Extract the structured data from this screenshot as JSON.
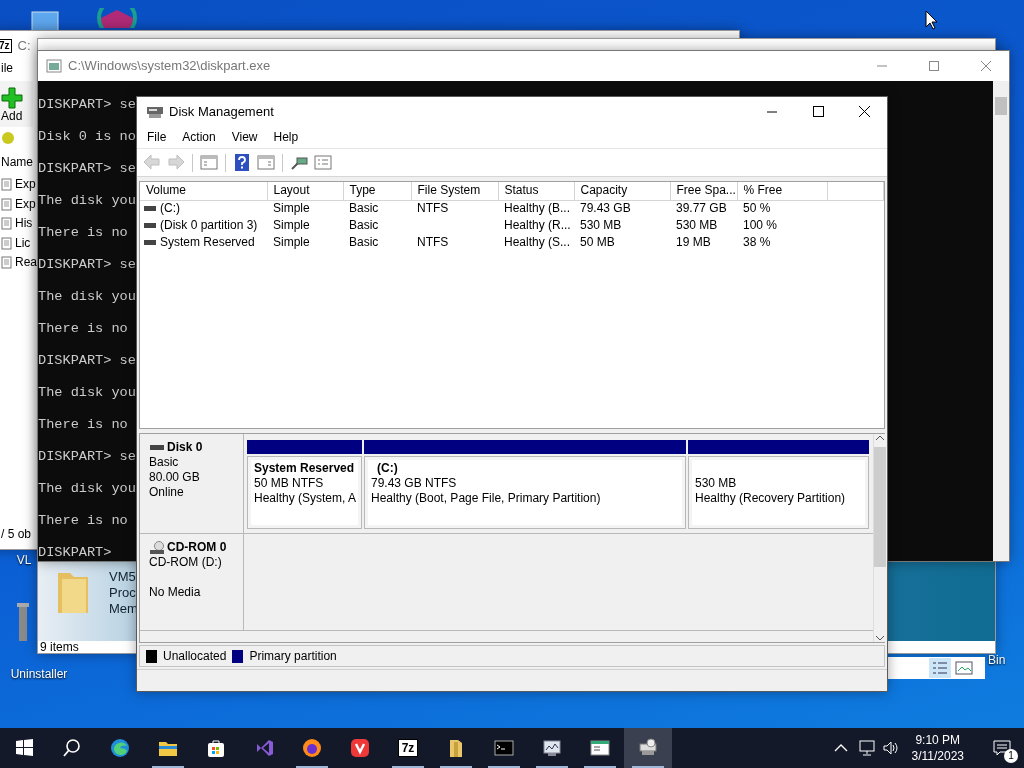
{
  "desktop": {
    "icons": [
      {
        "label": "VL"
      },
      {
        "label": "Uninstaller"
      },
      {
        "label": "Bin"
      }
    ]
  },
  "sevenzip_window": {
    "icon_label": "7z",
    "title": "C:",
    "menu": [
      "ile"
    ],
    "toolbar": [
      "Add"
    ],
    "column": "Name",
    "rows": [
      "Exp",
      "Exp",
      "His",
      "Lic",
      "Rea"
    ],
    "status": "/ 5 ob"
  },
  "explorer_window": {
    "preview_lines": [
      "VM5",
      "Proc",
      "Mem"
    ],
    "status": "9 items"
  },
  "console": {
    "title": "C:\\Windows\\system32\\diskpart.exe",
    "lines": [
      "DISKPART> se",
      "Disk 0 is no",
      "DISKPART> se",
      "The disk you",
      "There is no",
      "DISKPART> se",
      "The disk you",
      "There is no",
      "DISKPART> se",
      "The disk you",
      "There is no",
      "DISKPART> se",
      "The disk you",
      "There is no",
      "DISKPART>"
    ]
  },
  "disk_management": {
    "title": "Disk Management",
    "menu": [
      "File",
      "Action",
      "View",
      "Help"
    ],
    "toolbar": [
      {
        "kind": "back",
        "disabled": true
      },
      {
        "kind": "forward",
        "disabled": true
      },
      {
        "kind": "tree",
        "disabled": false
      },
      {
        "kind": "help",
        "disabled": false
      },
      {
        "kind": "pane",
        "disabled": false
      },
      {
        "kind": "connect",
        "disabled": false
      },
      {
        "kind": "props",
        "disabled": false
      }
    ],
    "columns": [
      "Volume",
      "Layout",
      "Type",
      "File System",
      "Status",
      "Capacity",
      "Free Spa...",
      "% Free"
    ],
    "rows": [
      {
        "cells": [
          "(C:)",
          "Simple",
          "Basic",
          "NTFS",
          "Healthy (B...",
          "79.43 GB",
          "39.77 GB",
          "50 %"
        ]
      },
      {
        "cells": [
          "(Disk 0 partition 3)",
          "Simple",
          "Basic",
          "",
          "Healthy (R...",
          "530 MB",
          "530 MB",
          "100 %"
        ]
      },
      {
        "cells": [
          "System Reserved",
          "Simple",
          "Basic",
          "NTFS",
          "Healthy (S...",
          "50 MB",
          "19 MB",
          "38 %"
        ]
      }
    ],
    "disks": [
      {
        "kind": "disk",
        "name": "Disk 0",
        "lines": [
          "Basic",
          "80.00 GB",
          "Online"
        ],
        "partitions": [
          {
            "name": "System Reserved",
            "size": "50 MB NTFS",
            "status": "Healthy (System, A",
            "color": "#000080"
          },
          {
            "name": "(C:)",
            "size": "79.43 GB NTFS",
            "status": "Healthy (Boot, Page File, Primary Partition)",
            "color": "#000080"
          },
          {
            "size": "530 MB",
            "status": "Healthy (Recovery Partition)",
            "color": "#000080"
          }
        ]
      },
      {
        "kind": "cdrom",
        "name": "CD-ROM 0",
        "lines": [
          "CD-ROM (D:)",
          "No Media"
        ]
      }
    ],
    "legend": [
      {
        "label": "Unallocated",
        "color": "#000000"
      },
      {
        "label": "Primary partition",
        "color": "#000080"
      }
    ]
  },
  "taskbar": {
    "items": [
      {
        "kind": "start"
      },
      {
        "kind": "search"
      },
      {
        "kind": "edge",
        "running": false,
        "selected": false
      },
      {
        "kind": "explorer",
        "running": true,
        "selected": false
      },
      {
        "kind": "store",
        "running": false,
        "selected": false
      },
      {
        "kind": "vs",
        "running": false,
        "selected": false
      },
      {
        "kind": "firefox",
        "running": true,
        "selected": false
      },
      {
        "kind": "vivaldi",
        "running": false,
        "selected": false
      },
      {
        "kind": "sevenzip",
        "label": "7z",
        "running": true,
        "selected": false
      },
      {
        "kind": "folder",
        "running": true,
        "selected": false
      },
      {
        "kind": "cmd",
        "running": true,
        "selected": false
      },
      {
        "kind": "monitor",
        "running": true,
        "selected": false
      },
      {
        "kind": "doc",
        "running": true,
        "selected": false
      },
      {
        "kind": "disk",
        "running": true,
        "selected": true
      }
    ],
    "time": "9:10 PM",
    "date": "3/11/2023",
    "notifications": "1"
  }
}
